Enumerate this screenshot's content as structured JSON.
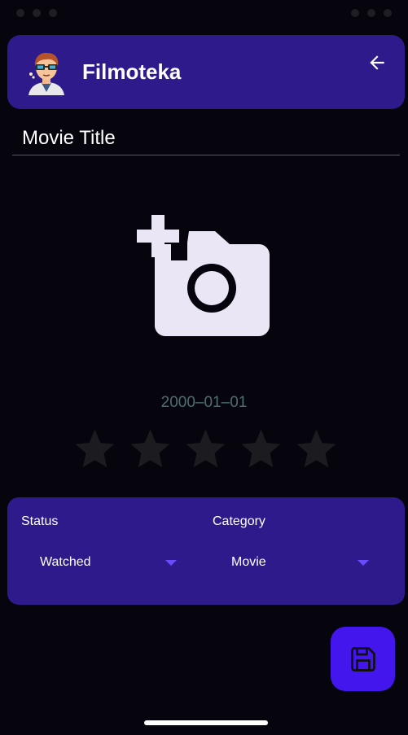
{
  "app": {
    "title": "Filmoteka"
  },
  "form": {
    "title_value": "Movie Title",
    "date": "2000–01–01",
    "rating": {
      "value": 0,
      "max": 5
    }
  },
  "options": {
    "status_label": "Status",
    "status_value": "Watched",
    "category_label": "Category",
    "category_value": "Movie"
  },
  "colors": {
    "background": "#06050d",
    "surface": "#2e1a8a",
    "accent": "#4316ee",
    "caret": "#6a4cff",
    "date_text": "#4f6e70",
    "star_empty": "#1c1c20",
    "icon_light": "#ebe6f5"
  },
  "icons": {
    "back": "arrow-left-icon",
    "photo": "add-photo-icon",
    "save": "floppy-disk-icon",
    "star": "star-icon"
  }
}
